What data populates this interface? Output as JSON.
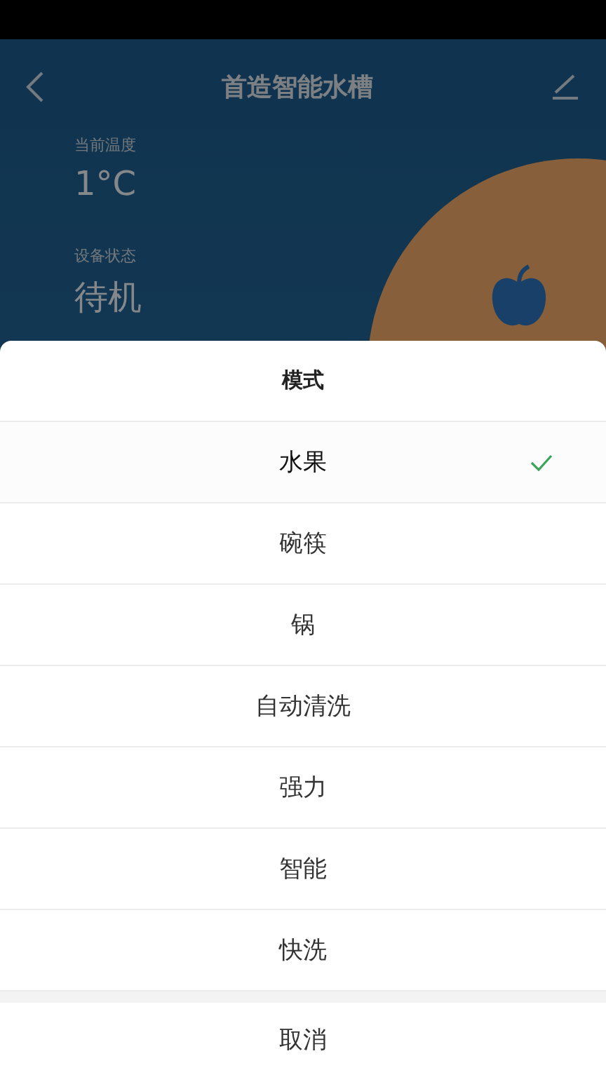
{
  "header": {
    "title": "首造智能水槽"
  },
  "stats": [
    {
      "label": "当前温度",
      "value": "1°C"
    },
    {
      "label": "设备状态",
      "value": "待机"
    }
  ],
  "sheet": {
    "title": "模式",
    "options": [
      {
        "label": "水果",
        "selected": true
      },
      {
        "label": "碗筷",
        "selected": false
      },
      {
        "label": "锅",
        "selected": false
      },
      {
        "label": "自动清洗",
        "selected": false
      },
      {
        "label": "强力",
        "selected": false
      },
      {
        "label": "智能",
        "selected": false
      },
      {
        "label": "快洗",
        "selected": false
      }
    ],
    "cancel": "取消"
  }
}
